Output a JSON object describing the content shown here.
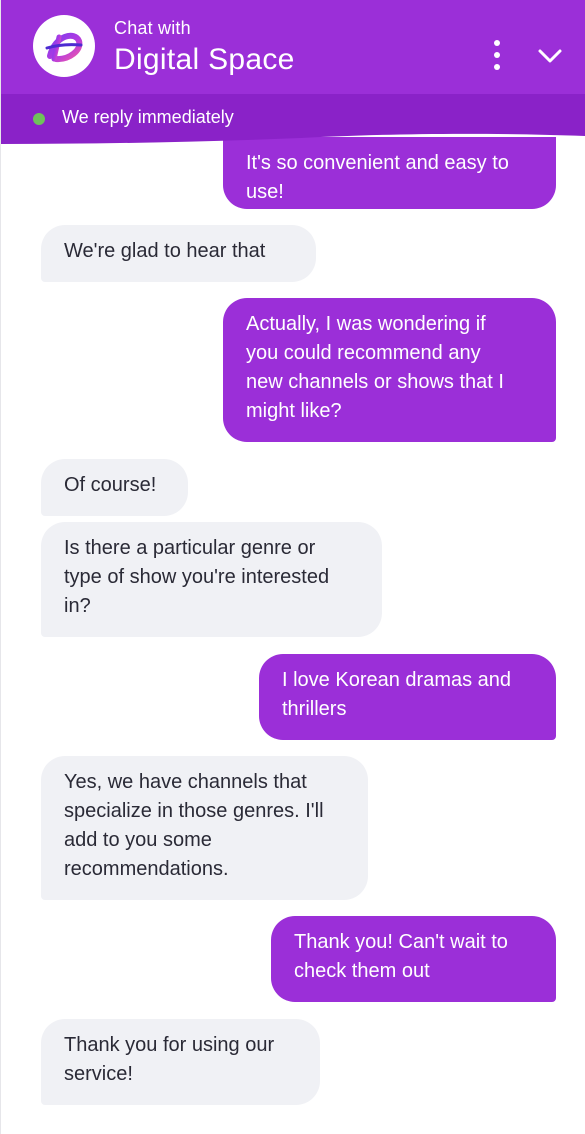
{
  "header": {
    "subtitle": "Chat with",
    "title": "Digital Space",
    "status": "We reply immediately",
    "brand_color": "#9b2fd8",
    "status_color": "#6fc25a",
    "logo_letter": "D"
  },
  "messages": [
    {
      "from": "user",
      "lines": [
        "It's so convenient and easy to",
        "use!"
      ]
    },
    {
      "from": "agent",
      "lines": [
        "We're glad to hear that"
      ]
    },
    {
      "from": "user",
      "lines": [
        "Actually, I was wondering if",
        "you could recommend any",
        "new channels or shows that I",
        "might like?"
      ]
    },
    {
      "from": "agent",
      "lines": [
        "Of course!"
      ]
    },
    {
      "from": "agent",
      "lines": [
        "Is there a particular genre or",
        "type of show you're interested",
        "in?"
      ]
    },
    {
      "from": "user",
      "lines": [
        "I love Korean dramas and",
        "thrillers"
      ]
    },
    {
      "from": "agent",
      "lines": [
        "Yes, we have channels that",
        "specialize in those genres. I'll",
        "add to you some",
        "recommendations."
      ]
    },
    {
      "from": "user",
      "lines": [
        "Thank you! Can't wait to",
        "check them out"
      ]
    },
    {
      "from": "agent",
      "lines": [
        "Thank you for using our",
        "service!"
      ]
    }
  ]
}
